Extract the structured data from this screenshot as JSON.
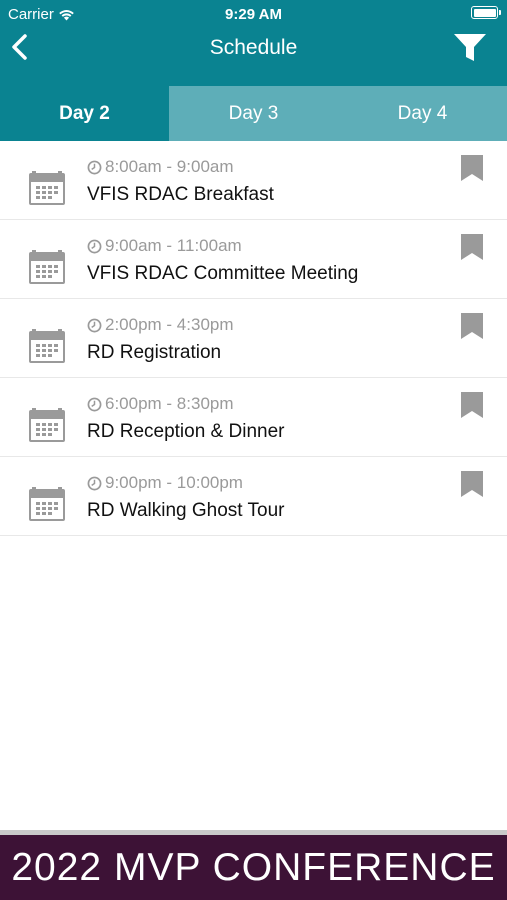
{
  "status_bar": {
    "carrier": "Carrier",
    "time": "9:29 AM"
  },
  "nav": {
    "title": "Schedule"
  },
  "tabs": [
    {
      "label": "Day 2",
      "active": true
    },
    {
      "label": "Day 3",
      "active": false
    },
    {
      "label": "Day 4",
      "active": false
    }
  ],
  "events": [
    {
      "time": "8:00am - 9:00am",
      "title": "VFIS RDAC Breakfast"
    },
    {
      "time": "9:00am - 11:00am",
      "title": "VFIS RDAC Committee Meeting"
    },
    {
      "time": "2:00pm - 4:30pm",
      "title": "RD Registration"
    },
    {
      "time": "6:00pm - 8:30pm",
      "title": "RD Reception & Dinner"
    },
    {
      "time": "9:00pm - 10:00pm",
      "title": "RD Walking Ghost Tour"
    }
  ],
  "footer": {
    "banner": "2022 MVP CONFERENCE"
  },
  "colors": {
    "header": "#0a8391",
    "tab_inactive": "#5eaeb8",
    "footer": "#3d1236",
    "muted": "#9a9a9a"
  },
  "icons": {
    "back": "chevron-left-icon",
    "filter": "funnel-icon",
    "event": "calendar-icon",
    "time": "clock-icon",
    "save": "bookmark-icon"
  }
}
